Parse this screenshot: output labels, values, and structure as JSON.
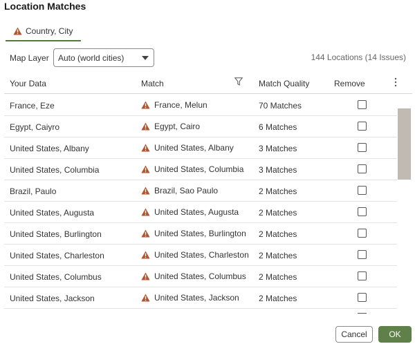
{
  "dialog": {
    "title": "Location Matches"
  },
  "tabs": [
    {
      "label": "Country, City"
    }
  ],
  "map_layer": {
    "label": "Map Layer",
    "value": "Auto (world cities)"
  },
  "summary": "144 Locations (14 Issues)",
  "columns": {
    "your_data": "Your Data",
    "match": "Match",
    "match_quality": "Match Quality",
    "remove": "Remove"
  },
  "rows": [
    {
      "your_data": "France, Eze",
      "match": "France, Melun",
      "quality": "70 Matches",
      "remove": false
    },
    {
      "your_data": "Egypt, Caiyro",
      "match": "Egypt, Cairo",
      "quality": "6 Matches",
      "remove": false
    },
    {
      "your_data": "United States, Albany",
      "match": "United States, Albany",
      "quality": "3 Matches",
      "remove": false
    },
    {
      "your_data": "United States, Columbia",
      "match": "United States, Columbia",
      "quality": "3 Matches",
      "remove": false
    },
    {
      "your_data": "Brazil, Paulo",
      "match": "Brazil, Sao Paulo",
      "quality": "2 Matches",
      "remove": false
    },
    {
      "your_data": "United States, Augusta",
      "match": "United States, Augusta",
      "quality": "2 Matches",
      "remove": false
    },
    {
      "your_data": "United States, Burlington",
      "match": "United States, Burlington",
      "quality": "2 Matches",
      "remove": false
    },
    {
      "your_data": "United States, Charleston",
      "match": "United States, Charleston",
      "quality": "2 Matches",
      "remove": false
    },
    {
      "your_data": "United States, Columbus",
      "match": "United States, Columbus",
      "quality": "2 Matches",
      "remove": false
    },
    {
      "your_data": "United States, Jackson",
      "match": "United States, Jackson",
      "quality": "2 Matches",
      "remove": false
    }
  ],
  "buttons": {
    "cancel": "Cancel",
    "ok": "OK"
  },
  "colors": {
    "warning": "#b5532c",
    "accent": "#517a3a",
    "ok_button": "#5f8048",
    "scrollbar_thumb": "#c0bab3"
  },
  "icons": {
    "warning": "warning-triangle-icon",
    "filter": "filter-icon",
    "more": "more-vertical-icon",
    "dropdown": "chevron-down-icon"
  }
}
